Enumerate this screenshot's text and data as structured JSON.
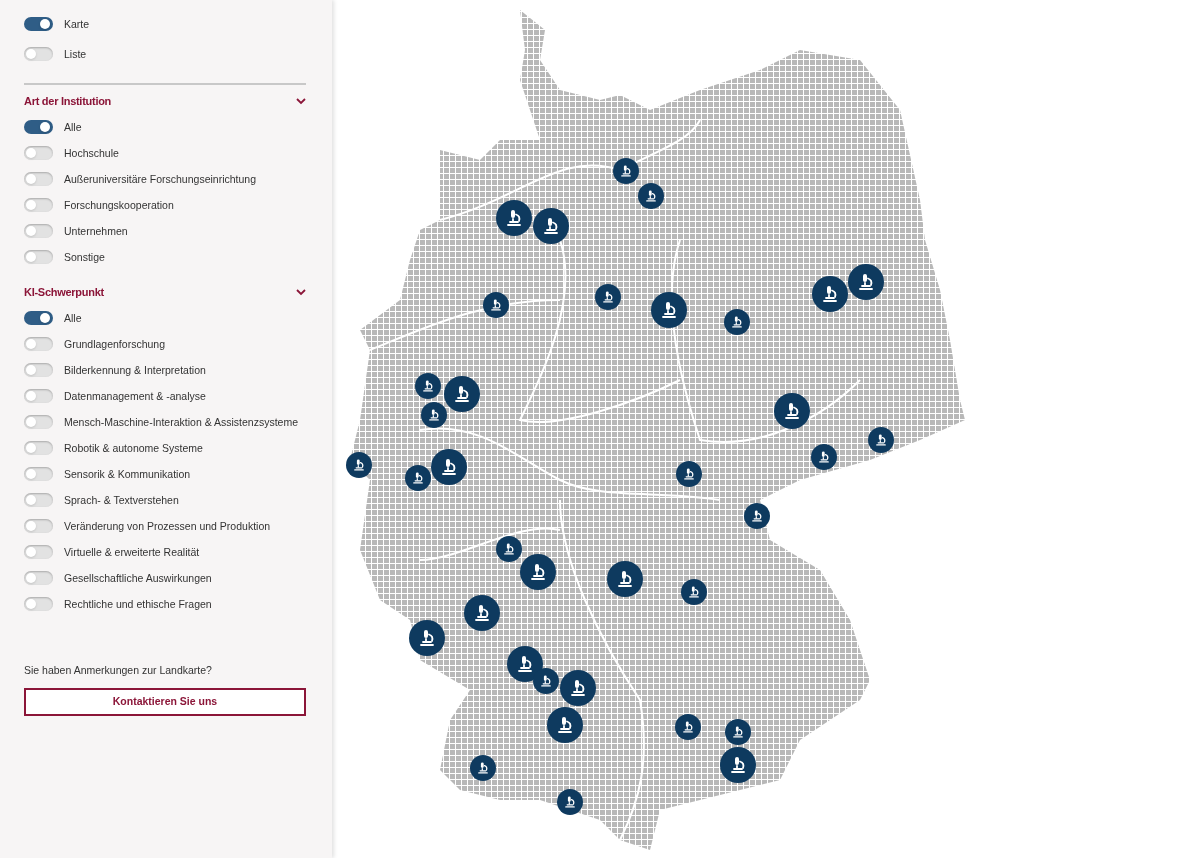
{
  "view_toggles": [
    {
      "label": "Karte",
      "on": true
    },
    {
      "label": "Liste",
      "on": false
    }
  ],
  "sections": [
    {
      "title": "Art der Institution",
      "expanded": true,
      "options": [
        {
          "label": "Alle",
          "on": true
        },
        {
          "label": "Hochschule",
          "on": false
        },
        {
          "label": "Außeruniversitäre Forschungseinrichtung",
          "on": false
        },
        {
          "label": "Forschungskooperation",
          "on": false
        },
        {
          "label": "Unternehmen",
          "on": false
        },
        {
          "label": "Sonstige",
          "on": false
        }
      ]
    },
    {
      "title": "KI-Schwerpunkt",
      "expanded": true,
      "options": [
        {
          "label": "Alle",
          "on": true
        },
        {
          "label": "Grundlagenforschung",
          "on": false
        },
        {
          "label": "Bilderkennung & Interpretation",
          "on": false
        },
        {
          "label": "Datenmanagement & -analyse",
          "on": false
        },
        {
          "label": "Mensch-Maschine-Interaktion & Assistenzsysteme",
          "on": false
        },
        {
          "label": "Robotik & autonome Systeme",
          "on": false
        },
        {
          "label": "Sensorik & Kommunikation",
          "on": false
        },
        {
          "label": "Sprach- & Textverstehen",
          "on": false
        },
        {
          "label": "Veränderung von Prozessen und Produktion",
          "on": false
        },
        {
          "label": "Virtuelle & erweiterte Realität",
          "on": false
        },
        {
          "label": "Gesellschaftliche Auswirkungen",
          "on": false
        },
        {
          "label": "Rechtliche und ethische Fragen",
          "on": false
        }
      ]
    }
  ],
  "feedback": {
    "prompt": "Sie haben Anmerkungen zur Landkarte?",
    "button": "Kontaktieren Sie uns"
  }
}
